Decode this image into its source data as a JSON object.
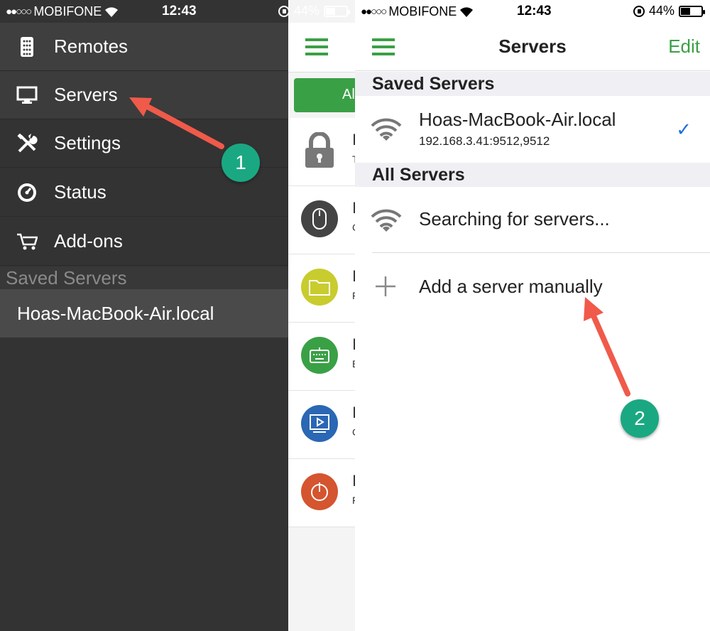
{
  "status_bar": {
    "carrier": "MOBIFONE",
    "time": "12:43",
    "battery": "44%",
    "signal_dots": "●●○○○",
    "battery_level": 0.44
  },
  "drawer": {
    "menu": [
      {
        "label": "Remotes",
        "icon": "remote-icon"
      },
      {
        "label": "Servers",
        "icon": "monitor-icon"
      },
      {
        "label": "Settings",
        "icon": "tools-icon"
      },
      {
        "label": "Status",
        "icon": "gauge-icon"
      },
      {
        "label": "Add-ons",
        "icon": "cart-icon"
      }
    ],
    "saved_servers_header": "Saved Servers",
    "saved_servers": [
      "Hoas-MacBook-Air.local"
    ]
  },
  "background_screen": {
    "button_partial": "Al",
    "rows": [
      {
        "icon": "lock-icon",
        "color": "#555555",
        "letter": "I",
        "sub": "T"
      },
      {
        "icon": "mouse-icon",
        "color": "#444444",
        "letter": "I",
        "sub": "C"
      },
      {
        "icon": "folder-icon",
        "color": "#c9cc2e",
        "letter": "I",
        "sub": "F"
      },
      {
        "icon": "keyboard-icon",
        "color": "#3aa046",
        "letter": "I",
        "sub": "E"
      },
      {
        "icon": "media-icon",
        "color": "#2a67b4",
        "letter": "I",
        "sub": "C"
      },
      {
        "icon": "power-icon",
        "color": "#d4552f",
        "letter": "I",
        "sub": "F"
      }
    ]
  },
  "servers_screen": {
    "title": "Servers",
    "edit_label": "Edit",
    "saved_header": "Saved Servers",
    "saved": [
      {
        "name": "Hoas-MacBook-Air.local",
        "address": "192.168.3.41:9512,9512",
        "selected": true
      }
    ],
    "all_header": "All Servers",
    "searching_label": "Searching for servers...",
    "add_manual_label": "Add a server manually"
  },
  "annotations": {
    "badge1": "1",
    "badge2": "2",
    "arrow_color": "#f05a4a",
    "badge_color": "#1aa882"
  },
  "colors": {
    "accent_green": "#3aa046",
    "check_blue": "#1d6fe0",
    "drawer_bg": "#333333"
  }
}
